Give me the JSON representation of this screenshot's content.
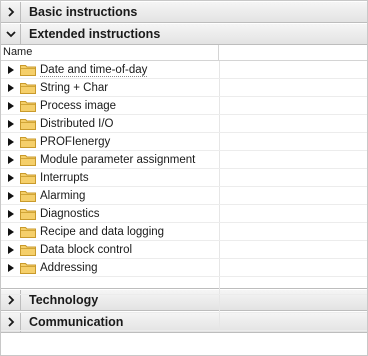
{
  "sections": {
    "basic": {
      "title": "Basic instructions",
      "state": "collapsed"
    },
    "extended": {
      "title": "Extended instructions",
      "state": "expanded"
    },
    "technology": {
      "title": "Technology",
      "state": "collapsed"
    },
    "communication": {
      "title": "Communication",
      "state": "collapsed"
    }
  },
  "list": {
    "column_header": "Name",
    "items": [
      {
        "label": "Date and time-of-day"
      },
      {
        "label": "String + Char"
      },
      {
        "label": "Process image"
      },
      {
        "label": "Distributed I/O"
      },
      {
        "label": "PROFIenergy"
      },
      {
        "label": "Module parameter assignment"
      },
      {
        "label": "Interrupts"
      },
      {
        "label": "Alarming"
      },
      {
        "label": "Diagnostics"
      },
      {
        "label": "Recipe and data logging"
      },
      {
        "label": "Data block control"
      },
      {
        "label": "Addressing"
      }
    ]
  },
  "icons": {
    "collapsed": "chevron-right-icon",
    "expanded": "chevron-down-icon",
    "expand_item": "triangle-right-icon",
    "folder": "folder-icon"
  },
  "colors": {
    "folder_fill": "#f5cf6a",
    "folder_stroke": "#c99a2b",
    "header_bg": "#e9e9e9"
  }
}
